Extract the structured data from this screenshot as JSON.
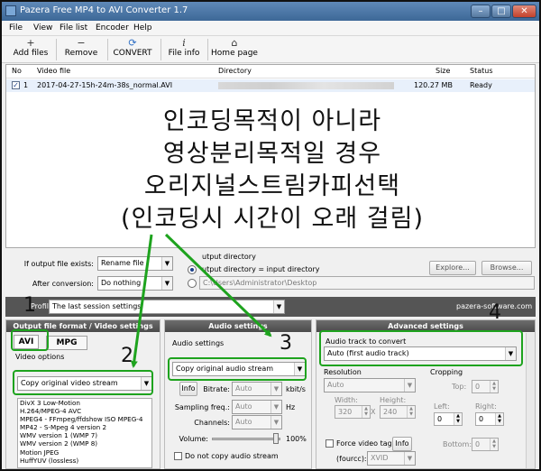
{
  "window": {
    "title": "Pazera Free MP4 to AVI Converter 1.7",
    "buttons": {
      "minimize": "–",
      "maximize": "□",
      "close": "✕"
    }
  },
  "menu": {
    "items": [
      "File",
      "View",
      "File list",
      "Encoder",
      "Help"
    ]
  },
  "toolbar": {
    "add_files": {
      "label": "Add files",
      "icon": "+"
    },
    "remove": {
      "label": "Remove",
      "icon": "−"
    },
    "convert": {
      "label": "CONVERT",
      "icon": "⟳"
    },
    "file_info": {
      "label": "File info",
      "icon": "i"
    },
    "home_page": {
      "label": "Home page",
      "icon": "⌂"
    }
  },
  "file_list": {
    "columns": {
      "no": "No",
      "video_file": "Video file",
      "directory": "Directory",
      "size": "Size",
      "status": "Status"
    },
    "rows": [
      {
        "checked": "✓",
        "no": "1",
        "file": "2017-04-27-15h-24m-38s_normal.AVI",
        "size": "120.27 MB",
        "status": "Ready"
      }
    ]
  },
  "overlay": {
    "lines": [
      "인코딩목적이 아니라",
      "영상분리목적일 경우",
      "오리지널스트림카피선택",
      "(인코딩시 시간이 오래 걸림)"
    ]
  },
  "output": {
    "if_exists_label": "If output file exists:",
    "if_exists_value": "Rename file",
    "after_conversion_label": "After conversion:",
    "after_conversion_value": "Do nothing",
    "output_directory_label": "utput directory",
    "input_directory_option": "utput directory = input directory",
    "custom_directory_path": "C:\\Users\\Administrator\\Desktop",
    "explore_button": "Explore...",
    "browse_button": "Browse..."
  },
  "profile": {
    "label": "Profile:",
    "value": "The last session settings",
    "website": "pazera-software.com"
  },
  "video_panel": {
    "title": "Output file format / Video settings",
    "tab_avi": "AVI",
    "tab_mpg": "MPG",
    "video_options_label": "Video options",
    "selected": "Copy original video stream",
    "options": [
      "DivX 3 Low-Motion",
      "H.264/MPEG-4 AVC",
      "MPEG4 - FFmpeg/ffdshow ISO MPEG-4",
      "MP42 - S-Mpeg 4 version 2",
      "WMV version 1 (WMP 7)",
      "WMV version 2 (WMP 8)",
      "Motion JPEG",
      "HuffYUV (lossless)"
    ]
  },
  "audio_panel": {
    "title": "Audio settings",
    "audio_options_label": "Audio settings",
    "selected": "Copy original audio stream",
    "info_button": "Info",
    "bitrate_label": "Bitrate:",
    "bitrate_value": "Auto",
    "bitrate_unit": "kbit/s",
    "sampling_label": "Sampling freq.:",
    "sampling_value": "Auto",
    "sampling_unit": "Hz",
    "channels_label": "Channels:",
    "channels_value": "Auto",
    "volume_label": "Volume:",
    "volume_value": "100%",
    "no_copy_label": "Do not copy audio stream"
  },
  "advanced_panel": {
    "title": "Advanced settings",
    "audio_track_label": "Audio track to convert",
    "audio_track_value": "Auto (first audio track)",
    "resolution_label": "Resolution",
    "resolution_value": "Auto",
    "width_label": "Width:",
    "width_value": "320",
    "height_label": "Height:",
    "height_value": "240",
    "times": "X",
    "cropping_label": "Cropping",
    "top_label": "Top:",
    "top_value": "0",
    "left_label": "Left:",
    "left_value": "0",
    "right_label": "Right:",
    "right_value": "0",
    "bottom_label": "Bottom:",
    "bottom_value": "0",
    "force_tag_label": "Force video tag",
    "info_button": "Info",
    "fourcc_label": "(fourcc):",
    "fourcc_value": "XVID"
  },
  "annotations": {
    "n1": "1",
    "n2": "2",
    "n3": "3",
    "n4": "4"
  },
  "colors": {
    "highlight": "#1ea31e",
    "titlebar": "#4a74a4",
    "panel_header": "#555555"
  }
}
